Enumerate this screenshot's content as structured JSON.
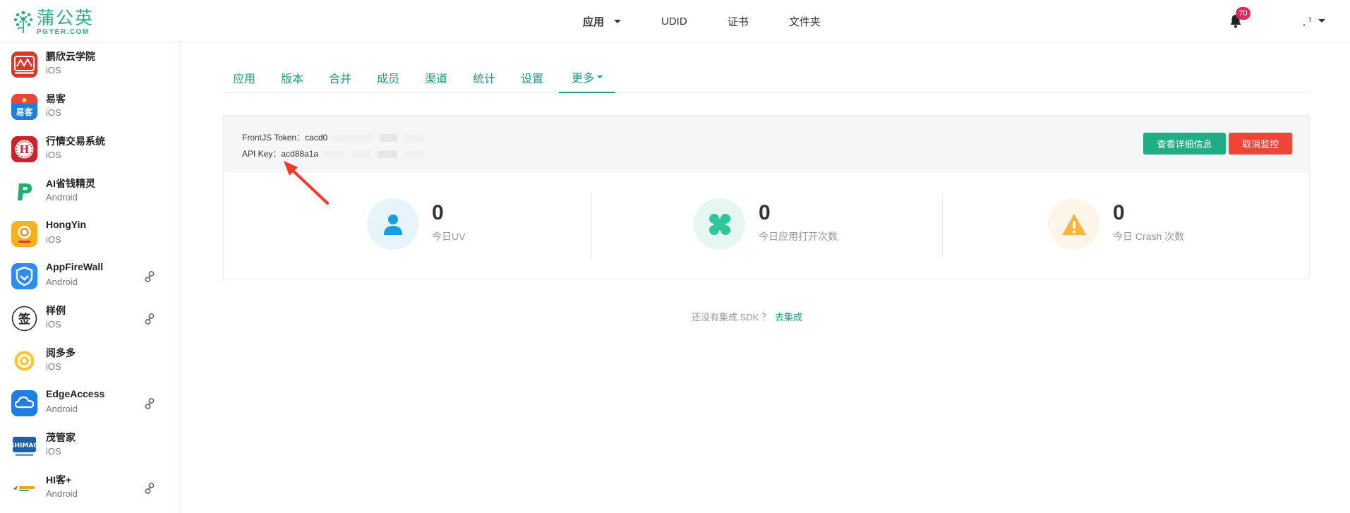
{
  "header": {
    "logo_cn": "蒲公英",
    "logo_en": "PGYER.COM",
    "nav": [
      {
        "label": "应用",
        "has_caret": true
      },
      {
        "label": "UDID"
      },
      {
        "label": "证书"
      },
      {
        "label": "文件夹"
      }
    ],
    "notification_count": "70",
    "user_label": "¸ ˀ",
    "bell_icon": "bell-icon"
  },
  "sidebar": {
    "items": [
      {
        "name": "鹏欣云学院",
        "platform": "iOS",
        "icon": "pengxin-app-icon",
        "linked": false
      },
      {
        "name": "易客",
        "platform": "iOS",
        "icon": "yike-app-icon",
        "linked": false
      },
      {
        "name": "行情交易系统",
        "platform": "iOS",
        "icon": "hangqing-app-icon",
        "linked": false
      },
      {
        "name": "AI省钱精灵",
        "platform": "Android",
        "icon": "ai-shengqian-app-icon",
        "linked": false
      },
      {
        "name": "HongYin",
        "platform": "iOS",
        "icon": "hongyin-app-icon",
        "linked": false
      },
      {
        "name": "AppFireWall",
        "platform": "Android",
        "icon": "appfirewall-app-icon",
        "linked": true
      },
      {
        "name": "样例",
        "platform": "iOS",
        "icon": "yangli-app-icon",
        "linked": true
      },
      {
        "name": "阅多多",
        "platform": "iOS",
        "icon": "yueduoduo-app-icon",
        "linked": false
      },
      {
        "name": "EdgeAccess",
        "platform": "Android",
        "icon": "edgeaccess-app-icon",
        "linked": true
      },
      {
        "name": "茂管家",
        "platform": "iOS",
        "icon": "maoguanjia-app-icon",
        "linked": false
      },
      {
        "name": "HI客+",
        "platform": "Android",
        "icon": "hike-app-icon",
        "linked": true
      }
    ]
  },
  "tabs": [
    {
      "label": "应用"
    },
    {
      "label": "版本"
    },
    {
      "label": "合并"
    },
    {
      "label": "成员"
    },
    {
      "label": "渠道"
    },
    {
      "label": "统计"
    },
    {
      "label": "设置"
    },
    {
      "label": "更多",
      "active": true,
      "has_caret": true
    }
  ],
  "keys": {
    "frontjs_label": "FrontJS Token：",
    "frontjs_value": "cacd0",
    "api_label": "API Key：",
    "api_value": "acd88a1a"
  },
  "buttons": {
    "detail": "查看详细信息",
    "cancel": "取消监控"
  },
  "stats": [
    {
      "value": "0",
      "label": "今日UV",
      "icon": "user-icon",
      "color": "#1a9ddb",
      "bg": "#e8f4fb"
    },
    {
      "value": "0",
      "label": "今日应用打开次数",
      "icon": "clover-icon",
      "color": "#2ec79b",
      "bg": "#e6f7f1"
    },
    {
      "value": "0",
      "label": "今日 Crash 次数",
      "icon": "warning-icon",
      "color": "#f5b53f",
      "bg": "#fdf5e8"
    }
  ],
  "sdk": {
    "note": "还没有集成 SDK ？",
    "link": "去集成"
  },
  "colors": {
    "accent": "#1a9e7c",
    "danger": "#f2453a",
    "badge": "#e5285c"
  }
}
